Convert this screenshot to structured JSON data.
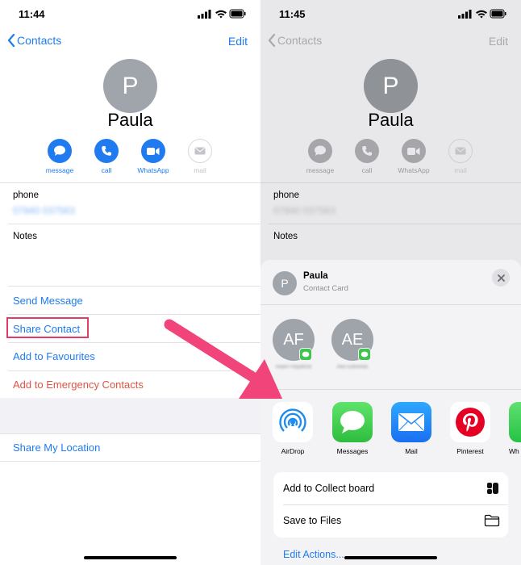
{
  "left": {
    "status": {
      "time": "11:44"
    },
    "nav": {
      "back_label": "Contacts",
      "edit_label": "Edit"
    },
    "contact": {
      "initial": "P",
      "name": "Paula"
    },
    "actions": [
      {
        "label": "message",
        "icon": "message-bubble-icon",
        "enabled": true
      },
      {
        "label": "call",
        "icon": "phone-icon",
        "enabled": true
      },
      {
        "label": "WhatsApp",
        "icon": "video-icon",
        "enabled": true
      },
      {
        "label": "mail",
        "icon": "envelope-icon",
        "enabled": false
      }
    ],
    "phone": {
      "label": "phone",
      "value": "07840 037563"
    },
    "notes": {
      "label": "Notes"
    },
    "rows": {
      "send_message": "Send Message",
      "share_contact": "Share Contact",
      "add_favourites": "Add to Favourites",
      "add_emergency": "Add to Emergency Contacts",
      "share_location": "Share My Location"
    }
  },
  "right": {
    "status": {
      "time": "11:45"
    },
    "nav": {
      "back_label": "Contacts",
      "edit_label": "Edit"
    },
    "contact": {
      "initial": "P",
      "name": "Paula"
    },
    "actions": [
      {
        "label": "message"
      },
      {
        "label": "call"
      },
      {
        "label": "WhatsApp"
      },
      {
        "label": "mail"
      }
    ],
    "phone": {
      "label": "phone",
      "value": "07840 037563"
    },
    "notes": {
      "label": "Notes"
    },
    "sheet": {
      "header": {
        "initial": "P",
        "name": "Paula",
        "subtitle": "Contact Card"
      },
      "people": [
        {
          "initials": "AF",
          "name": "Adam Fitzpatrick"
        },
        {
          "initials": "AE",
          "name": "Alex Edmonds"
        }
      ],
      "apps": [
        {
          "label": "AirDrop"
        },
        {
          "label": "Messages"
        },
        {
          "label": "Mail"
        },
        {
          "label": "Pinterest"
        },
        {
          "label": "Wh"
        }
      ],
      "list": [
        {
          "label": "Add to Collect board"
        },
        {
          "label": "Save to Files"
        }
      ],
      "edit_actions": "Edit Actions..."
    }
  },
  "colors": {
    "accent": "#1f7bef",
    "destructive": "#e05442",
    "highlight": "#e43c69",
    "arrow": "#f0447a"
  }
}
